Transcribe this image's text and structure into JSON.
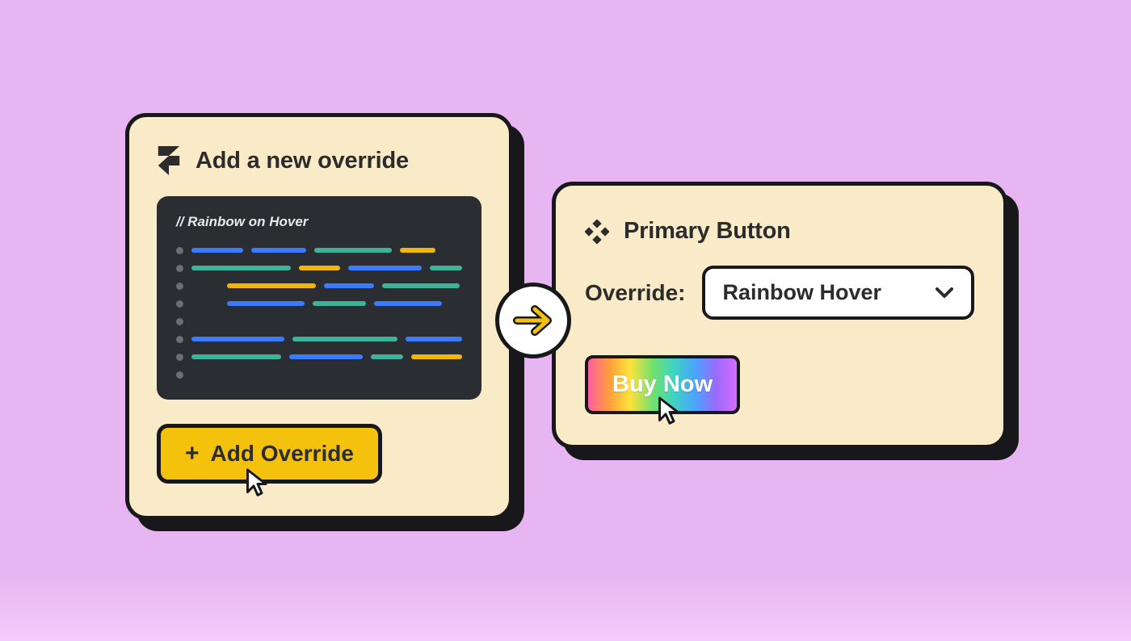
{
  "left_card": {
    "title": "Add a new override",
    "code_comment": "// Rainbow on Hover",
    "add_button_label": "Add Override"
  },
  "right_card": {
    "title": "Primary Button",
    "override_label": "Override:",
    "select_value": "Rainbow Hover",
    "buy_label": "Buy Now"
  },
  "icons": {
    "framer": "framer-icon",
    "diamond": "diamond-icon",
    "plus": "plus-icon",
    "chevron": "chevron-down-icon",
    "arrow": "arrow-right-icon",
    "cursor": "cursor-icon"
  },
  "colors": {
    "bg": "#e6b5f2",
    "card": "#faebc8",
    "stroke": "#18181a",
    "gold": "#f4c20d",
    "code_bg": "#2a2d32"
  }
}
